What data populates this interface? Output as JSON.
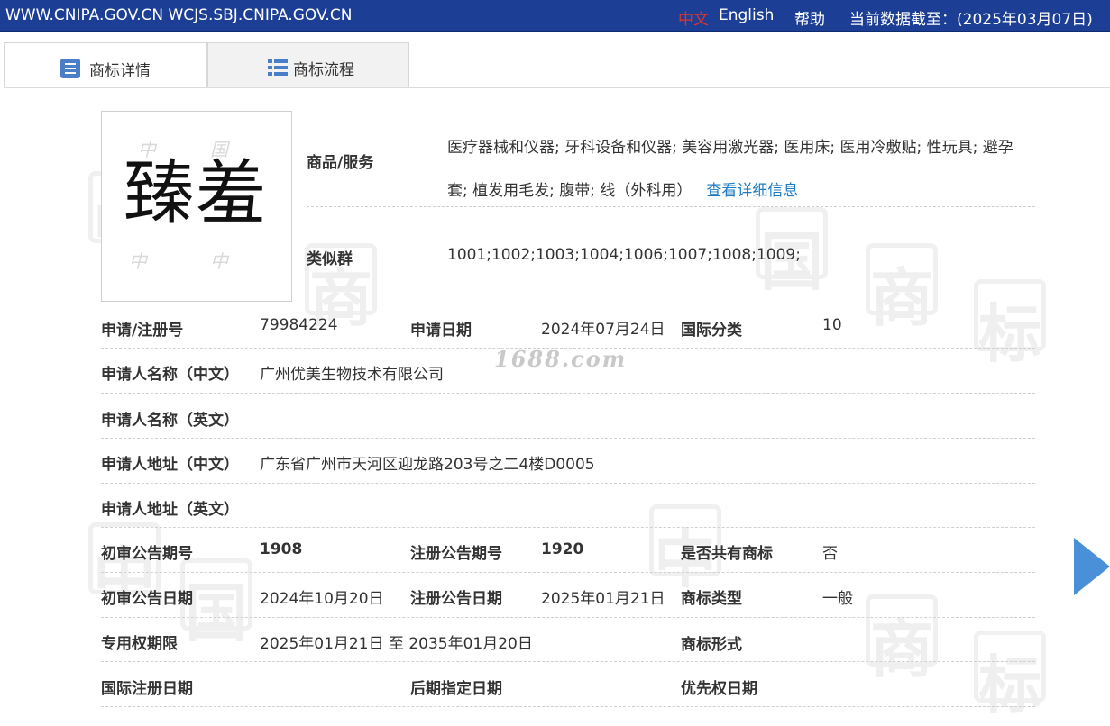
{
  "topbar": {
    "site": "WWW.CNIPA.GOV.CN WCJS.SBJ.CNIPA.GOV.CN",
    "lang_zh": "中文",
    "lang_en": "English",
    "help": "帮助",
    "as_of": "当前数据截至：(2025年03月07日)"
  },
  "tabs": [
    {
      "label": "商标详情",
      "icon": "list-doc-icon",
      "active": true
    },
    {
      "label": "商标流程",
      "icon": "list-bullets-icon",
      "active": false
    }
  ],
  "mark": {
    "text": "臻羞",
    "watermark_glyphs": [
      "中",
      "国",
      "中",
      "中"
    ]
  },
  "goods": {
    "label": "商品/服务",
    "text": "医疗器械和仪器; 牙科设备和仪器; 美容用激光器; 医用床; 医用冷敷贴; 性玩具; 避孕套; 植发用毛发; 腹带; 线（外科用）",
    "link": "查看详细信息"
  },
  "similar_group": {
    "label": "类似群",
    "value": "1001;1002;1003;1004;1006;1007;1008;1009;"
  },
  "fields": {
    "reg_no_label": "申请/注册号",
    "reg_no": "79984224",
    "apply_date_label": "申请日期",
    "apply_date": "2024年07月24日",
    "intl_class_label": "国际分类",
    "intl_class": "10",
    "applicant_cn_label": "申请人名称（中文）",
    "applicant_cn": "广州优美生物技术有限公司",
    "applicant_en_label": "申请人名称（英文）",
    "applicant_en": "",
    "address_cn_label": "申请人地址（中文）",
    "address_cn": "广东省广州市天河区迎龙路203号之二4楼D0005",
    "address_en_label": "申请人地址（英文）",
    "address_en": "",
    "prelim_no_label": "初审公告期号",
    "prelim_no": "1908",
    "reg_pub_no_label": "注册公告期号",
    "reg_pub_no": "1920",
    "shared_label": "是否共有商标",
    "shared": "否",
    "prelim_date_label": "初审公告日期",
    "prelim_date": "2024年10月20日",
    "reg_pub_date_label": "注册公告日期",
    "reg_pub_date": "2025年01月21日",
    "mark_type_label": "商标类型",
    "mark_type": "一般",
    "exclusive_label": "专用权期限",
    "exclusive": "2025年01月21日 至 2035年01月20日",
    "mark_form_label": "商标形式",
    "mark_form": "",
    "intl_reg_date_label": "国际注册日期",
    "later_designation_label": "后期指定日期",
    "priority_date_label": "优先权日期"
  },
  "watermark_1688": "1688.com",
  "bg_watermark_glyphs": [
    "中",
    "国",
    "商",
    "标"
  ],
  "colors": {
    "topbar": "#1c3f95",
    "lang_zh": "#e0332a",
    "link": "#1e7bc4",
    "arrow": "#4a90d9"
  }
}
